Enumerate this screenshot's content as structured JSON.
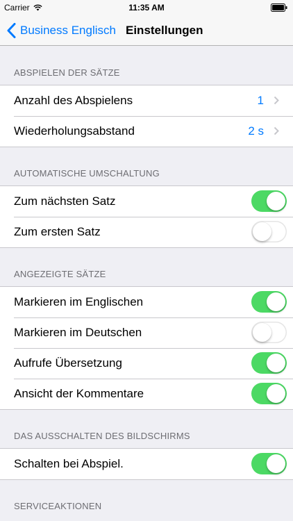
{
  "status_bar": {
    "carrier": "Carrier",
    "time": "11:35 AM",
    "wifi_icon": "wifi-icon",
    "battery_icon": "battery-icon"
  },
  "nav": {
    "back_label": "Business Englisch",
    "title": "Einstellungen",
    "back_icon": "chevron-left-icon"
  },
  "colors": {
    "accent": "#007aff",
    "switch_on": "#4cd964",
    "background": "#efeff4"
  },
  "sections": {
    "playback": {
      "header": "ABSPIELEN DER SÄTZE",
      "rows": [
        {
          "label": "Anzahl des Abspielens",
          "value": "1"
        },
        {
          "label": "Wiederholungsabstand",
          "value": "2 s"
        }
      ]
    },
    "auto_switch": {
      "header": "AUTOMATISCHE UMSCHALTUNG",
      "rows": [
        {
          "label": "Zum nächsten Satz",
          "on": true
        },
        {
          "label": "Zum ersten Satz",
          "on": false
        }
      ]
    },
    "displayed": {
      "header": "ANGEZEIGTE SÄTZE",
      "rows": [
        {
          "label": "Markieren im Englischen",
          "on": true
        },
        {
          "label": "Markieren im Deutschen",
          "on": false
        },
        {
          "label": "Aufrufe Übersetzung",
          "on": true
        },
        {
          "label": "Ansicht der Kommentare",
          "on": true
        }
      ]
    },
    "screen_off": {
      "header": "DAS AUSSCHALTEN DES BILDSCHIRMS",
      "rows": [
        {
          "label": "Schalten bei Abspiel.",
          "on": true
        }
      ]
    },
    "service": {
      "header": "SERVICEAKTIONEN"
    }
  }
}
